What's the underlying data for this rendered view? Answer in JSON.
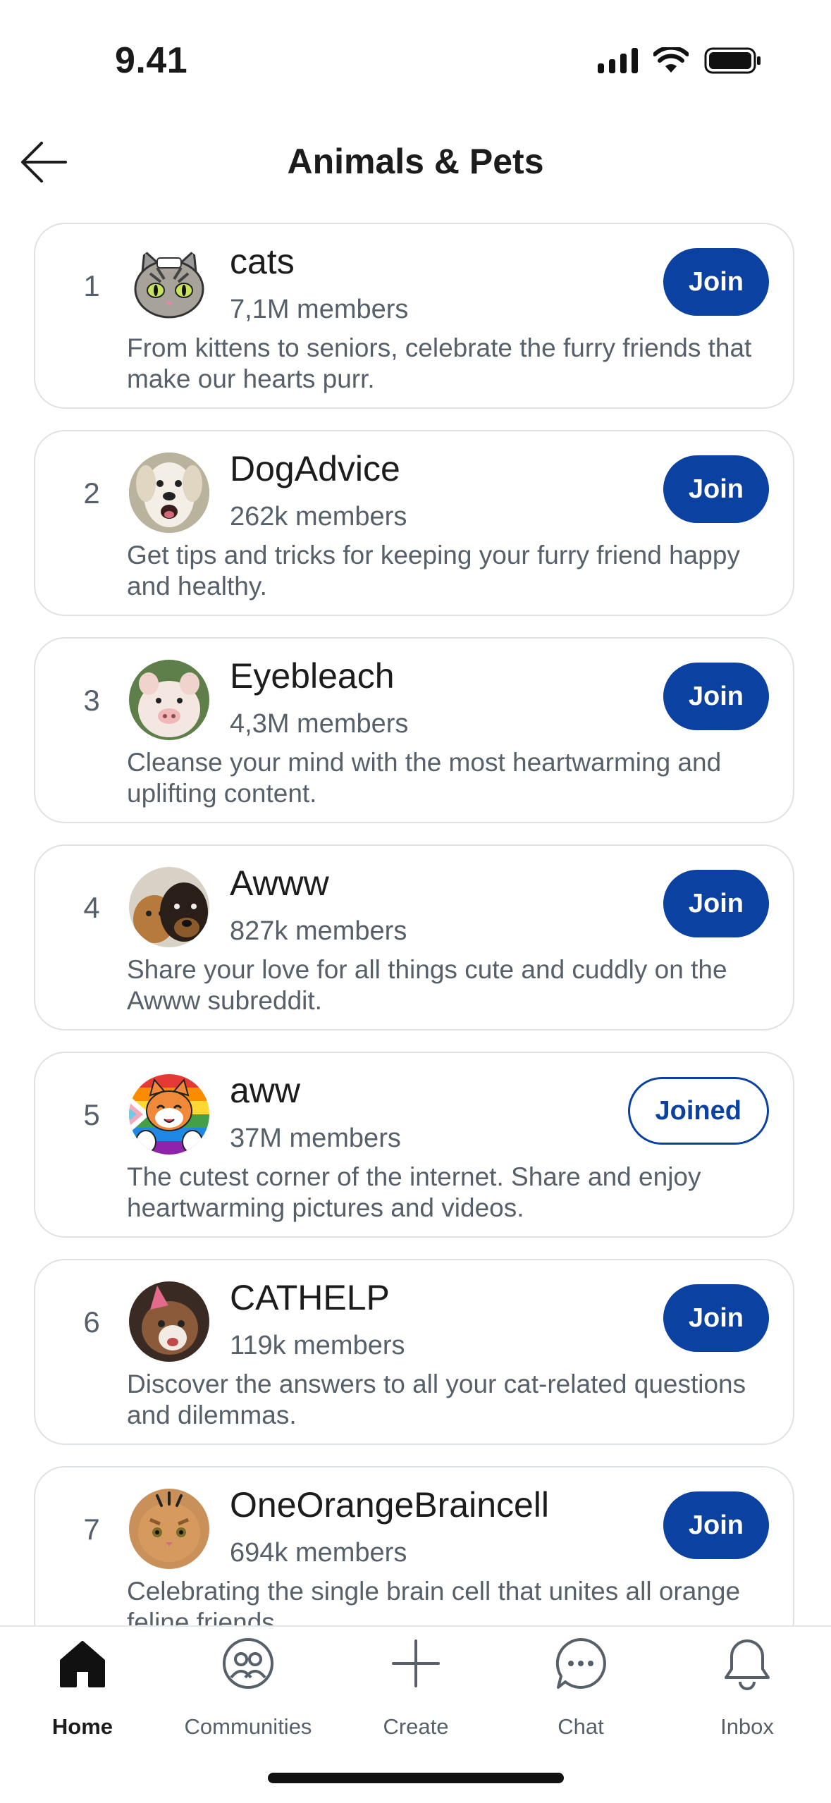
{
  "status_bar": {
    "time": "9.41"
  },
  "header": {
    "title": "Animals & Pets"
  },
  "communities": [
    {
      "rank": "1",
      "name": "cats",
      "members": "7,1M members",
      "description": "From kittens to seniors, celebrate the furry friends that make our hearts purr.",
      "button": "Join"
    },
    {
      "rank": "2",
      "name": "DogAdvice",
      "members": "262k members",
      "description": "Get tips and tricks for keeping your furry friend happy and healthy.",
      "button": "Join"
    },
    {
      "rank": "3",
      "name": "Eyebleach",
      "members": "4,3M members",
      "description": "Cleanse your mind with the most heartwarming and uplifting content.",
      "button": "Join"
    },
    {
      "rank": "4",
      "name": "Awww",
      "members": "827k members",
      "description": "Share your love for all things cute and cuddly on the Awww subreddit.",
      "button": "Join"
    },
    {
      "rank": "5",
      "name": "aww",
      "members": "37M members",
      "description": "The cutest corner of the internet. Share and enjoy heartwarming pictures and videos.",
      "button": "Joined"
    },
    {
      "rank": "6",
      "name": "CATHELP",
      "members": "119k members",
      "description": "Discover the answers to all your cat-related questions and dilemmas.",
      "button": "Join"
    },
    {
      "rank": "7",
      "name": "OneOrangeBraincell",
      "members": "694k members",
      "description": "Celebrating the single brain cell that unites all orange feline friends.",
      "button": "Join"
    }
  ],
  "bottom_nav": {
    "home": "Home",
    "communities": "Communities",
    "create": "Create",
    "chat": "Chat",
    "inbox": "Inbox"
  },
  "colors": {
    "accent": "#0b41a0",
    "muted_text": "#576069",
    "border": "#dfe2e5"
  },
  "icons": [
    "back-arrow-icon",
    "signal-icon",
    "wifi-icon",
    "battery-icon",
    "home-icon",
    "communities-icon",
    "create-plus-icon",
    "chat-icon",
    "bell-icon"
  ]
}
